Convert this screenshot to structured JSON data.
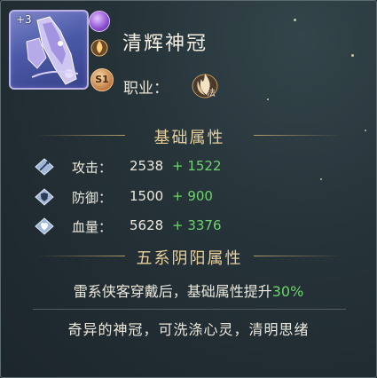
{
  "item": {
    "enhance_level": "+3",
    "name": "清辉神冠",
    "badge": "S1",
    "job_label": "职业：",
    "job_class": "法"
  },
  "sections": {
    "base_attributes": "基础属性",
    "element_attributes": "五系阴阳属性"
  },
  "stats": [
    {
      "name": "攻击：",
      "value": "2538",
      "bonus": "+ 1522",
      "icon": "attack-icon"
    },
    {
      "name": "防御：",
      "value": "1500",
      "bonus": "+ 900",
      "icon": "defense-icon"
    },
    {
      "name": "血量：",
      "value": "5628",
      "bonus": "+ 3376",
      "icon": "hp-icon"
    }
  ],
  "bonus_text": {
    "prefix": "雷系侠客穿戴后，基础属性提升",
    "percent": "30%"
  },
  "description": "奇异的神冠，可洗涤心灵，清明思绪",
  "colors": {
    "positive_green": "#6ed26e",
    "section_gold": "#e8cf9c",
    "item_purple": "#4b5aa8"
  }
}
